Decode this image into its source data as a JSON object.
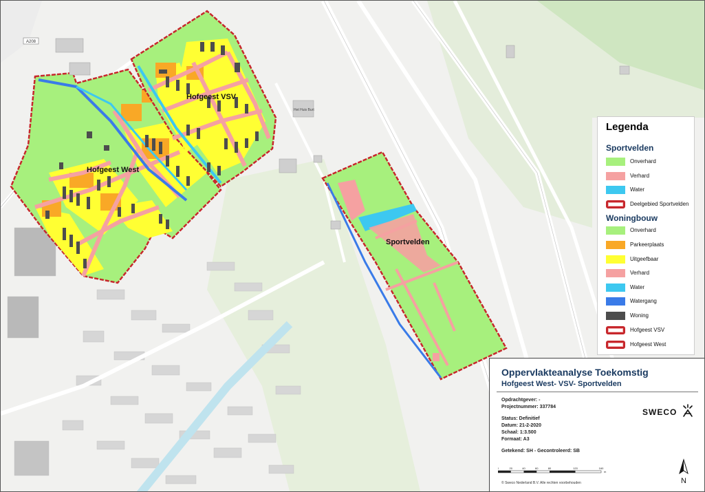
{
  "map_labels": {
    "hofgeest_vsv": "Hofgeest VSV",
    "hofgeest_west": "Hofgeest West",
    "sportvelden": "Sportvelden",
    "road_a208": "A208",
    "hof_huis_text": "Het Huis Burt"
  },
  "legend": {
    "title": "Legenda",
    "sportvelden": {
      "heading": "Sportvelden",
      "items": [
        {
          "label": "Onverhard",
          "color": "#a7f07d"
        },
        {
          "label": "Verhard",
          "color": "#f5a1a1"
        },
        {
          "label": "Water",
          "color": "#3dc8f0"
        },
        {
          "label": "Deelgebied Sportvelden",
          "color": "#c7272c",
          "outline": true
        }
      ]
    },
    "woningbouw": {
      "heading": "Woningbouw",
      "items": [
        {
          "label": "Onverhard",
          "color": "#a7f07d"
        },
        {
          "label": "Parkeerplaats",
          "color": "#f9a826"
        },
        {
          "label": "Uitgeefbaar",
          "color": "#ffff33"
        },
        {
          "label": "Verhard",
          "color": "#f5a1a1"
        },
        {
          "label": "Water",
          "color": "#3dc8f0"
        },
        {
          "label": "Watergang",
          "color": "#3a7be8"
        },
        {
          "label": "Woning",
          "color": "#4d4d4d"
        },
        {
          "label": "Hofgeest VSV",
          "color": "#c7272c",
          "outline": true
        },
        {
          "label": "Hofgeest West",
          "color": "#c7272c",
          "outline": true
        }
      ]
    }
  },
  "cartouche": {
    "title": "Oppervlakteanalyse Toekomstig",
    "subtitle": "Hofgeest West- VSV- Sportvelden",
    "opdrachtgever": "Opdrachtgever: -",
    "projectnummer": "Projectnummer: 337784",
    "status": "Status: Definitief",
    "datum": "Datum: 21-2-2020",
    "schaal": "Schaal: 1:3.500",
    "formaat": "Formaat: A3",
    "getekend": "Getekend: SH - Gecontroleerd: SB",
    "company": "SWECO",
    "scale_ticks": [
      "0",
      "20",
      "40",
      "60",
      "80",
      "120",
      "160"
    ],
    "scale_unit": "m",
    "north": "N",
    "copyright": "© Sweco Nederland B.V. Alle rechten voorbehouden"
  },
  "colors": {
    "background": "#f3f3f3",
    "road_light": "#ffffff",
    "canal": "#bfe3ee",
    "green_area": "#e3efd9",
    "building": "#d0d0d0",
    "boundary": "#c7272c"
  }
}
